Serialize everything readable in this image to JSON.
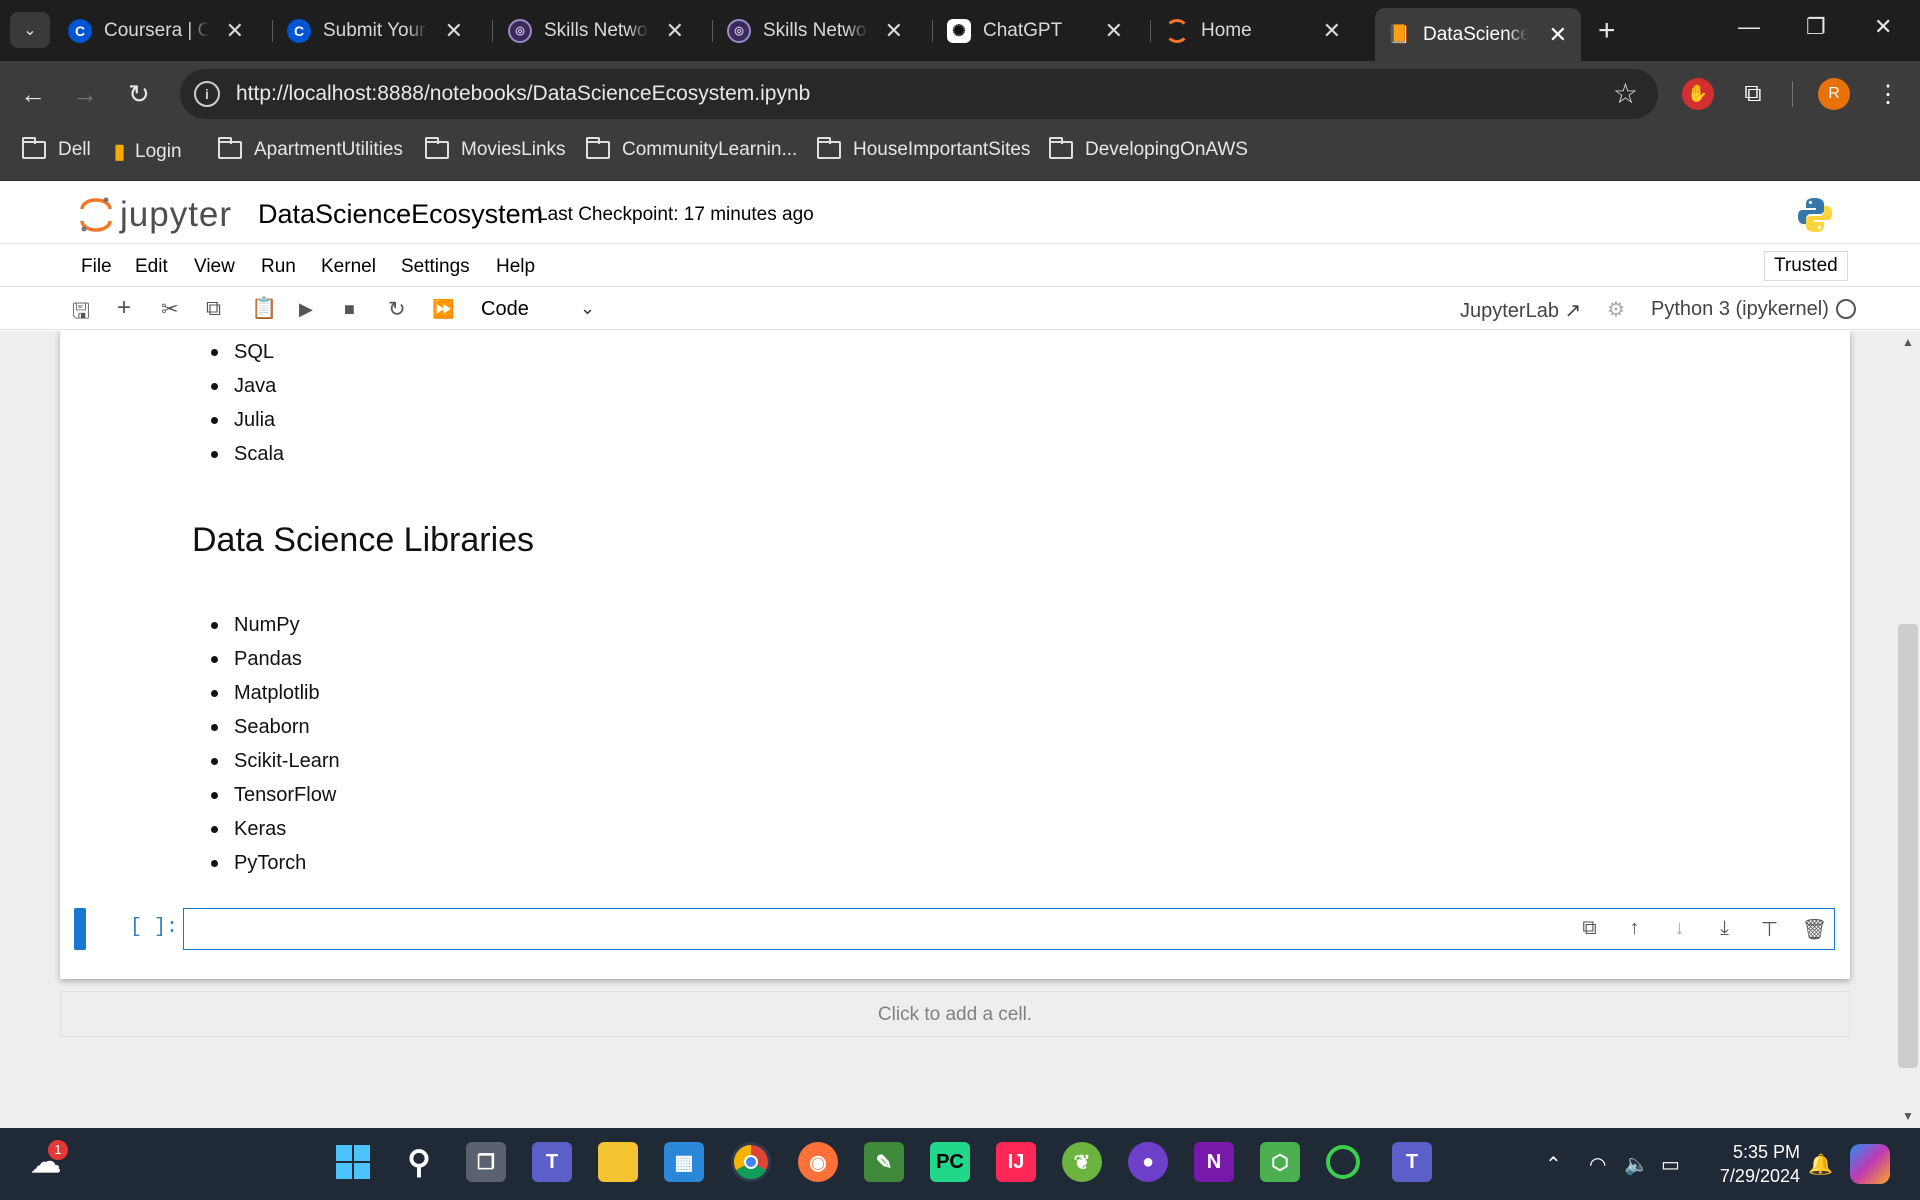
{
  "browser": {
    "tabs": [
      {
        "label": "Coursera | Onl",
        "icon": "coursera-icon"
      },
      {
        "label": "Submit Your W",
        "icon": "coursera-icon"
      },
      {
        "label": "Skills Network",
        "icon": "skills-network-icon"
      },
      {
        "label": "Skills Network",
        "icon": "skills-network-icon"
      },
      {
        "label": "ChatGPT",
        "icon": "chatgpt-icon"
      },
      {
        "label": "Home",
        "icon": "jupyter-icon"
      },
      {
        "label": "DataScienceEc",
        "icon": "notebook-icon"
      }
    ],
    "url": "http://localhost:8888/notebooks/DataScienceEcosystem.ipynb",
    "profile_initial": "R",
    "bookmarks": [
      "Dell",
      "Login",
      "ApartmentUtilities",
      "MoviesLinks",
      "CommunityLearnin...",
      "HouseImportantSites",
      "DevelopingOnAWS"
    ]
  },
  "jupyter": {
    "logo_text": "jupyter",
    "notebook_title": "DataScienceEcosystem",
    "checkpoint": "Last Checkpoint: 17 minutes ago",
    "menu": [
      "File",
      "Edit",
      "View",
      "Run",
      "Kernel",
      "Settings",
      "Help"
    ],
    "trusted": "Trusted",
    "cell_type": "Code",
    "jupyterlab_link": "JupyterLab",
    "kernel_name": "Python 3 (ipykernel)"
  },
  "notebook": {
    "languages_tail": [
      "SQL",
      "Java",
      "Julia",
      "Scala"
    ],
    "libraries_heading": "Data Science Libraries",
    "libraries": [
      "NumPy",
      "Pandas",
      "Matplotlib",
      "Seaborn",
      "Scikit-Learn",
      "TensorFlow",
      "Keras",
      "PyTorch"
    ],
    "code_prompt": "[ ]:",
    "add_cell_text": "Click to add a cell."
  },
  "taskbar": {
    "weather_badge": "1",
    "time": "5:35 PM",
    "date": "7/29/2024"
  },
  "colors": {
    "accent": "#1976d2",
    "prompt": "#307fc1",
    "jupyter_orange": "#f37726"
  }
}
